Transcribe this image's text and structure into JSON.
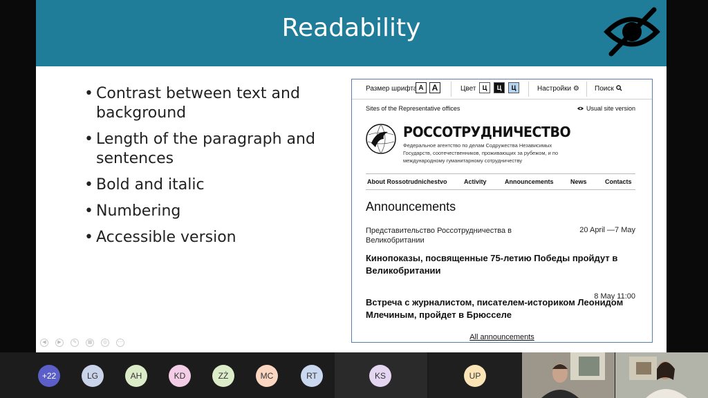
{
  "slide": {
    "title": "Readability",
    "icon": "eye-slash-icon",
    "bullets": [
      "Contrast between text and background",
      "Length of the paragraph and sentences",
      "Bold and italic",
      "Numbering",
      "Accessible version"
    ]
  },
  "website": {
    "toolbar": {
      "font_size_label": "Размер шрифта",
      "font_size_small": "A",
      "font_size_large": "A",
      "color_label": "Цвет",
      "color_options": [
        "Ц",
        "Ц",
        "Ц"
      ],
      "settings_label": "Настройки",
      "search_label": "Поиск"
    },
    "sites_link": "Sites of the Representative offices",
    "usual_version": "Usual site version",
    "org_name": "РОССОТРУДНИЧЕСТВО",
    "org_description": "Федеральное агентство по делам Содружества Независимых Государств, соотечественников, проживающих за рубежом, и по международному гуманитарному сотрудничеству",
    "nav": [
      "About Rossotrudnichestvo",
      "Activity",
      "Announcements",
      "News",
      "Contacts"
    ],
    "section_title": "Announcements",
    "items": [
      {
        "source": "Представительство Россотрудничества в Великобритании",
        "date": "20 April —7 May",
        "title": "Кинопоказы, посвященные 75-летию Победы пройдут в Великобритании"
      },
      {
        "source": "",
        "date": "8 May 11:00",
        "title": "Встреча с журналистом, писателем-историком Леонидом Млечиным, пройдет в Брюсселе"
      }
    ],
    "all_link": "All announcements"
  },
  "participants": [
    {
      "initials": "+22",
      "color": "#5b5fc7"
    },
    {
      "initials": "LG",
      "color": "#c9d4ea"
    },
    {
      "initials": "AH",
      "color": "#dcebc8"
    },
    {
      "initials": "KD",
      "color": "#f3cde6"
    },
    {
      "initials": "ZŻ",
      "color": "#dcebc8"
    },
    {
      "initials": "MC",
      "color": "#fbd7c1"
    },
    {
      "initials": "RT",
      "color": "#c9d8ee"
    },
    {
      "initials": "KS",
      "color": "#e4d5f0"
    },
    {
      "initials": "UP",
      "color": "#fbe5b6"
    }
  ],
  "colors": {
    "title_bar": "#1f7d9a",
    "color_option_bg": [
      "#ffffff",
      "#111111",
      "#b7d3f2"
    ]
  }
}
